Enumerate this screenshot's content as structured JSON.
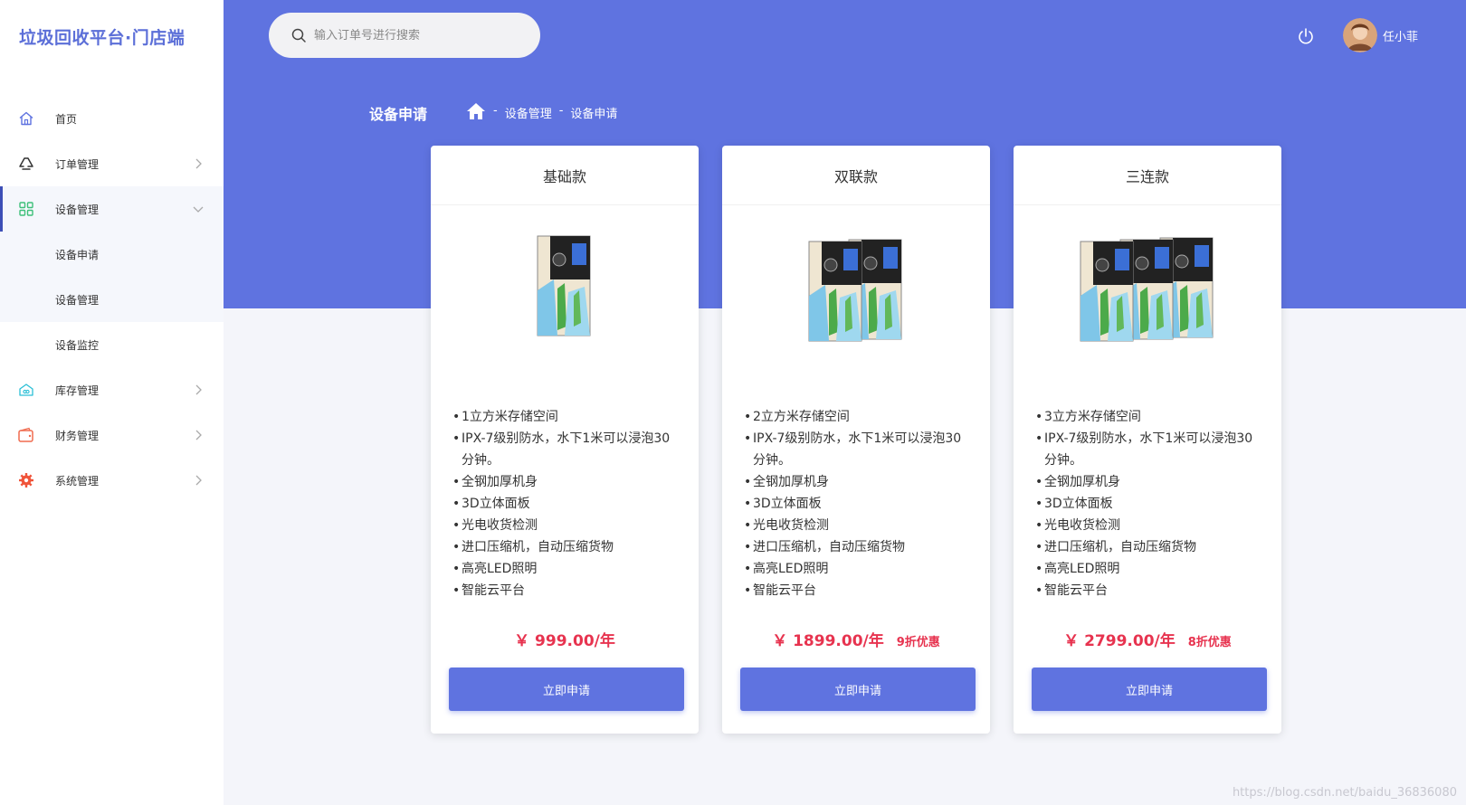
{
  "app": {
    "title": "垃圾回收平台·门店端"
  },
  "sidebar": {
    "items": [
      {
        "label": "首页"
      },
      {
        "label": "订单管理"
      },
      {
        "label": "设备管理"
      },
      {
        "label": "库存管理"
      },
      {
        "label": "财务管理"
      },
      {
        "label": "系统管理"
      }
    ],
    "submenu": [
      {
        "label": "设备申请"
      },
      {
        "label": "设备管理"
      },
      {
        "label": "设备监控"
      }
    ]
  },
  "header": {
    "search_placeholder": "输入订单号进行搜索",
    "username": "任小菲"
  },
  "page": {
    "title": "设备申请",
    "breadcrumb": [
      "-",
      "设备管理",
      "-",
      "设备申请"
    ]
  },
  "cards": [
    {
      "title": "基础款",
      "units": 1,
      "features": [
        "1立方米存储空间",
        "IPX-7级别防水，水下1米可以浸泡30分钟。",
        "全钢加厚机身",
        "3D立体面板",
        "光电收货检测",
        "进口压缩机，自动压缩货物",
        "高亮LED照明",
        "智能云平台"
      ],
      "price": "￥ 999.00/年",
      "discount": "",
      "button": "立即申请"
    },
    {
      "title": "双联款",
      "units": 2,
      "features": [
        "2立方米存储空间",
        "IPX-7级别防水，水下1米可以浸泡30分钟。",
        "全钢加厚机身",
        "3D立体面板",
        "光电收货检测",
        "进口压缩机，自动压缩货物",
        "高亮LED照明",
        "智能云平台"
      ],
      "price": "￥ 1899.00/年",
      "discount": "9折优惠",
      "button": "立即申请"
    },
    {
      "title": "三连款",
      "units": 3,
      "features": [
        "3立方米存储空间",
        "IPX-7级别防水，水下1米可以浸泡30分钟。",
        "全钢加厚机身",
        "3D立体面板",
        "光电收货检测",
        "进口压缩机，自动压缩货物",
        "高亮LED照明",
        "智能云平台"
      ],
      "price": "￥ 2799.00/年",
      "discount": "8折优惠",
      "button": "立即申请"
    }
  ],
  "watermark": "https://blog.csdn.net/baidu_36836080",
  "colors": {
    "primary": "#5f73e0",
    "price": "#e7334f",
    "sidebar_active": "#3d4fb6"
  },
  "icons": [
    "home-icon",
    "recycle-icon",
    "grid-icon",
    "warehouse-icon",
    "wallet-icon",
    "gear-icon",
    "chevron-right-icon",
    "chevron-down-icon",
    "search-icon",
    "power-icon"
  ]
}
